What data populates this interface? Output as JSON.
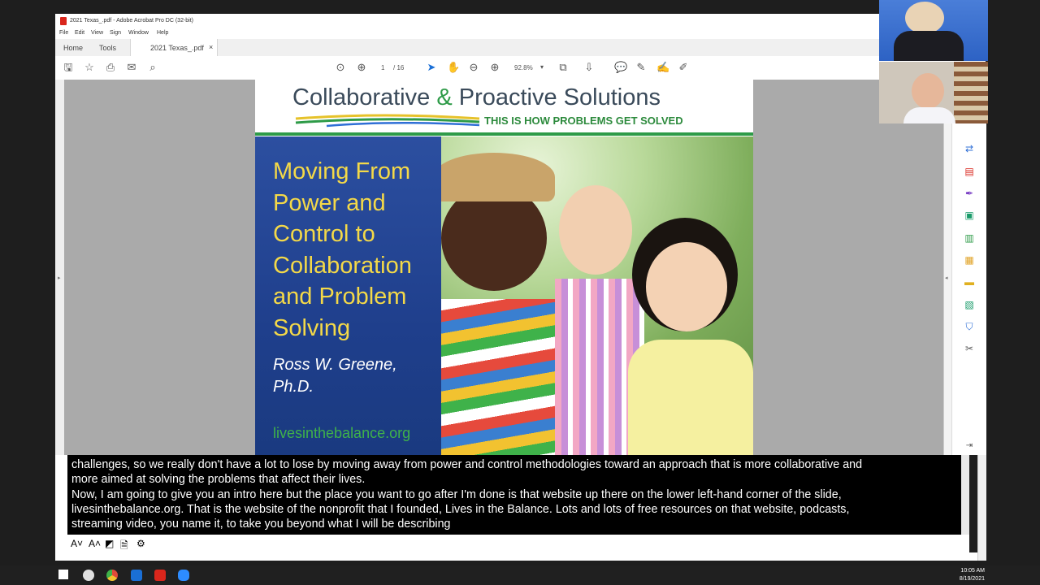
{
  "window": {
    "title": "2021 Texas_.pdf - Adobe Acrobat Pro DC (32-bit)",
    "menu": [
      "File",
      "Edit",
      "View",
      "Sign",
      "Window",
      "Help"
    ]
  },
  "tabs": {
    "home": "Home",
    "tools": "Tools",
    "document": "2021 Texas_.pdf",
    "close": "×"
  },
  "toolbar": {
    "page_current": "1",
    "page_total": "/ 16",
    "zoom": "92.8%"
  },
  "slide": {
    "brand_left": "Collaborative ",
    "brand_amp": "&",
    "brand_right": " Proactive Solutions",
    "tagline": "THIS IS HOW PROBLEMS GET SOLVED",
    "title": "Moving From Power and Control to Collaboration and Problem Solving",
    "author_line1": "Ross W. Greene,",
    "author_line2": "Ph.D.",
    "website": "livesinthebalance.org"
  },
  "caption": {
    "lines": [
      "challenges, so we really don't have a lot to lose by moving away from power and control methodologies toward an approach that is more collaborative and",
      "more aimed at solving the problems that affect their lives.",
      "     Now, I am going to give you an intro here but the place you want to go after I'm done is that website up there on the lower left-hand corner of the slide,",
      "livesinthebalance.org.  That is the website of the nonprofit that I founded, Lives in the Balance.  Lots and lots of free resources on that website, podcasts,",
      "streaming video, you name it, to take you beyond what I will be describing"
    ]
  },
  "clock": {
    "time": "10:05 AM",
    "date": "8/19/2021"
  },
  "colors": {
    "brand_green": "#2e9b48",
    "title_yellow": "#f4d948",
    "panel_blue": "#1f3f8c",
    "acrobat_red": "#d9261c"
  }
}
